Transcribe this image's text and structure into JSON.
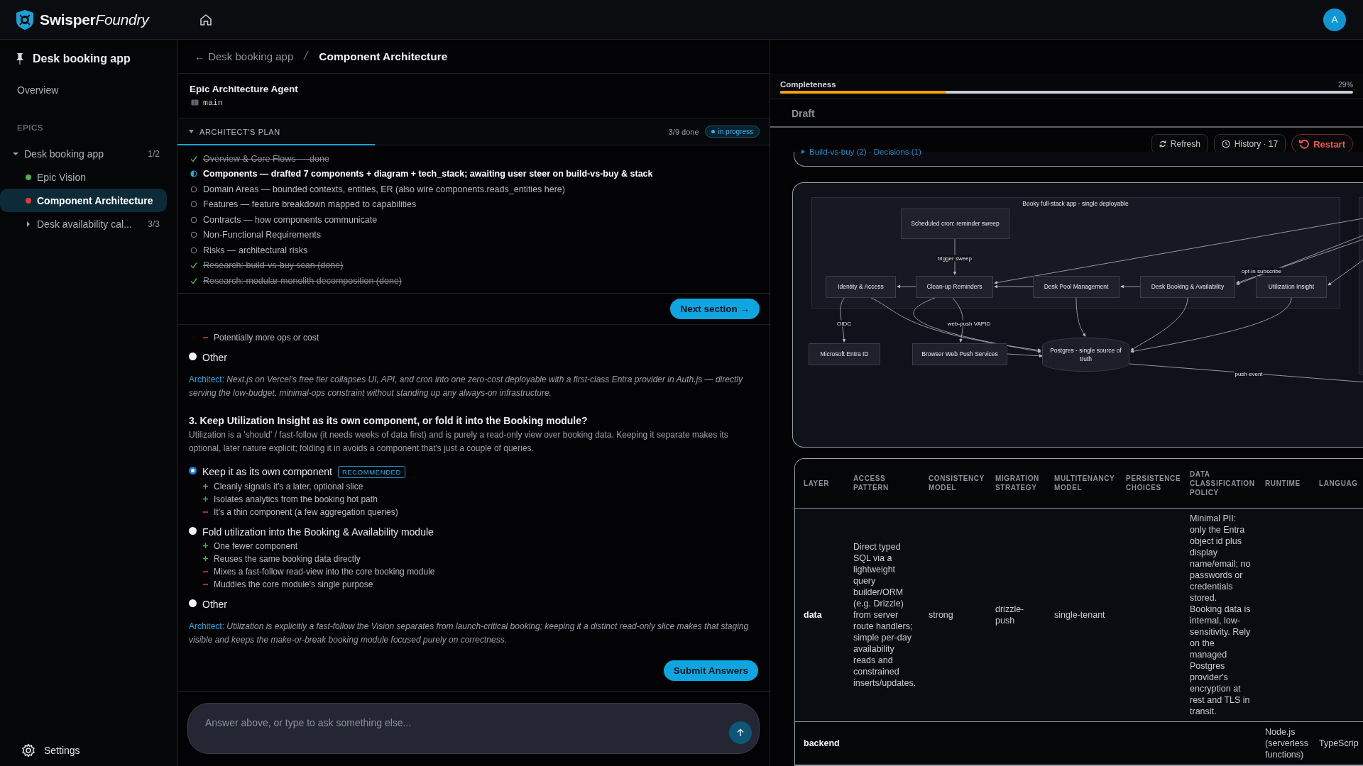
{
  "app": {
    "brand": "Swisper",
    "brand_suffix": "Foundry",
    "avatar": "A"
  },
  "sidebar": {
    "project": "Desk booking app",
    "nav": [
      {
        "label": "Overview",
        "selected": false
      }
    ],
    "section": "EPICS",
    "tree": [
      {
        "kind": "group",
        "label": "Desk booking app",
        "count": "1/2",
        "expanded": true,
        "selected": false,
        "children": [
          {
            "kind": "leaf",
            "label": "Epic Vision",
            "color": "#4caf50",
            "selected": false
          },
          {
            "kind": "leaf",
            "label": "Component Architecture",
            "color": "#e53935",
            "selected": true
          },
          {
            "kind": "group",
            "label": "Desk availability cal...",
            "count": "3/3",
            "expanded": false,
            "selected": false
          }
        ]
      }
    ],
    "settings": "Settings"
  },
  "breadcrumb": {
    "back": "← Desk booking app",
    "current": "Component Architecture"
  },
  "agent": {
    "name": "Epic Architecture Agent",
    "branch": "main"
  },
  "plan": {
    "title": "ARCHITECT'S PLAN",
    "expanded": true,
    "progress": "3/9 done",
    "status": "in progress",
    "level": 0.333,
    "items": [
      {
        "kind": "done",
        "text": "Overview & Core Flows — done"
      },
      {
        "kind": "active",
        "text": "Components — drafted 7 components + diagram + tech_stack; awaiting user steer on build-vs-buy & stack"
      },
      {
        "kind": "pending",
        "text": "Domain Areas — bounded contexts, entities, ER (also wire components.reads_entities here)"
      },
      {
        "kind": "pending",
        "text": "Features — feature breakdown mapped to capabilities"
      },
      {
        "kind": "pending",
        "text": "Contracts — how components communicate"
      },
      {
        "kind": "pending",
        "text": "Non-Functional Requirements"
      },
      {
        "kind": "pending",
        "text": "Risks — architectural risks"
      },
      {
        "kind": "done",
        "text": "Research: build-vs-buy scan (done)"
      },
      {
        "kind": "done",
        "text": "Research: modular monolith decomposition (done)"
      }
    ]
  },
  "next_button": "Next section →",
  "questions": [
    {
      "points": [
        {
          "kind": "con",
          "text": "Potentially more ops or cost"
        }
      ],
      "options": [
        {
          "label": "Other",
          "selected": false
        }
      ],
      "note_label": "Architect:",
      "note": "Next.js on Vercel's free tier collapses UI, API, and cron into one zero-cost deployable with a first-class Entra provider in Auth.js — directly serving the low-budget, minimal-ops constraint without standing up any always-on infrastructure."
    },
    {
      "title": "3. Keep Utilization Insight as its own component, or fold it into the Booking module?",
      "description": "Utilization is a 'should' / fast-follow (it needs weeks of data first) and is purely a read-only view over booking data. Keeping it separate makes its optional, later nature explicit; folding it in avoids a component that's just a couple of queries.",
      "options": [
        {
          "label": "Keep it as its own component",
          "selected": true,
          "badge": "RECOMMENDED",
          "points": [
            {
              "kind": "pro",
              "text": "Cleanly signals it's a later, optional slice"
            },
            {
              "kind": "pro",
              "text": "Isolates analytics from the booking hot path"
            },
            {
              "kind": "con",
              "text": "It's a thin component (a few aggregation queries)"
            }
          ]
        },
        {
          "label": "Fold utilization into the Booking & Availability module",
          "selected": false,
          "points": [
            {
              "kind": "pro",
              "text": "One fewer component"
            },
            {
              "kind": "pro",
              "text": "Reuses the same booking data directly"
            },
            {
              "kind": "con",
              "text": "Mixes a fast-follow read-view into the core booking module"
            },
            {
              "kind": "con",
              "text": "Muddies the core module's single purpose"
            }
          ]
        },
        {
          "label": "Other",
          "selected": false
        }
      ],
      "note_label": "Architect:",
      "note": "Utilization is explicitly a fast-follow the Vision separates from launch-critical booking; keeping it a distinct read-only slice makes that staging visible and keeps the make-or-break booking module focused purely on correctness."
    }
  ],
  "submit_button": "Submit Answers",
  "composer": {
    "placeholder": "Answer above, or type to ask something else..."
  },
  "completeness": {
    "label": "Completeness",
    "value": "29%",
    "level": 0.29
  },
  "draft_title": "Draft",
  "toolbar": [
    {
      "kind": "refresh",
      "label": "Refresh"
    },
    {
      "kind": "history",
      "label": "History · 17"
    },
    {
      "kind": "restart",
      "label": "Restart"
    }
  ],
  "summary_link": "Build-vs-buy (2) · Decisions (1)",
  "diagram": {
    "group": "Booky full-stack app - single deployable",
    "nodes": [
      {
        "kind": "box",
        "label": "Scheduled cron: reminder sweep"
      },
      {
        "kind": "box",
        "label": "Identity & Access"
      },
      {
        "kind": "box",
        "label": "Clean-up Reminders"
      },
      {
        "kind": "box",
        "label": "Desk Pool Management"
      },
      {
        "kind": "box",
        "label": "Desk Booking & Availability"
      },
      {
        "kind": "box",
        "label": "Utilization Insight"
      },
      {
        "kind": "box",
        "label": "Microsoft Entra ID"
      },
      {
        "kind": "box",
        "label": "Browser Web Push Services"
      },
      {
        "kind": "database",
        "label": "Postgres - single source of truth"
      }
    ],
    "edge_labels": [
      "trigger sweep",
      "opt-in subscribe",
      "OIDC",
      "web-push VAPID",
      "push event"
    ]
  },
  "table": {
    "columns": [
      "LAYER",
      "ACCESS PATTERN",
      "CONSISTENCY MODEL",
      "MIGRATION STRATEGY",
      "MULTITENANCY MODEL",
      "PERSISTENCE CHOICES",
      "DATA CLASSIFICATION POLICY",
      "RUNTIME",
      "LANGUAG"
    ],
    "rows": [
      [
        "data",
        "Direct typed SQL via a lightweight query builder/ORM (e.g. Drizzle) from server route handlers; simple per-day availability reads and constrained inserts/updates.",
        "strong",
        "drizzle-push",
        "single-tenant",
        "",
        "Minimal PII: only the Entra object id plus display name/email; no passwords or credentials stored. Booking data is internal, low-sensitivity. Rely on the managed Postgres provider's encryption at rest and TLS in transit.",
        "",
        ""
      ],
      [
        "backend",
        "",
        "",
        "",
        "",
        "",
        "",
        "Node.js (serverless functions)",
        "TypeScrip"
      ]
    ]
  }
}
